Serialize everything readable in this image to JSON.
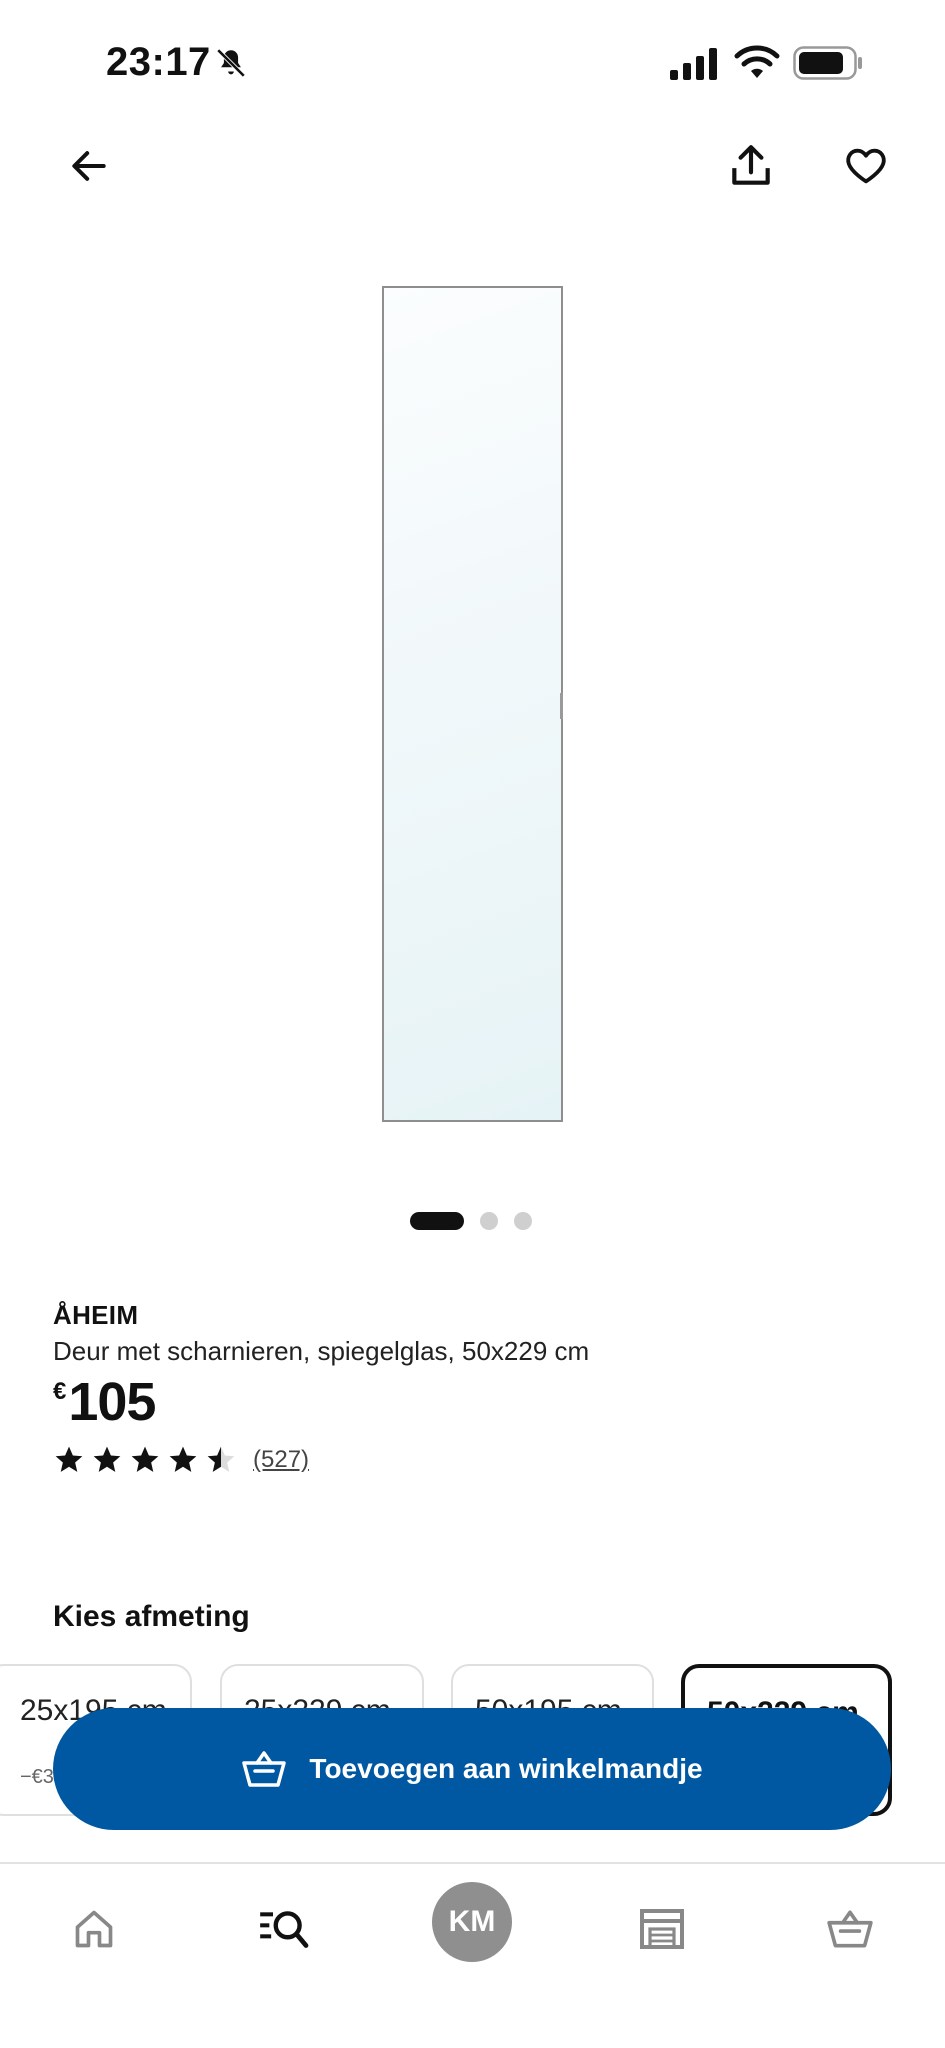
{
  "status_bar": {
    "time": "23:17",
    "icons": [
      "bell-slash-icon",
      "cellular-signal-icon",
      "wifi-icon",
      "battery-icon"
    ]
  },
  "top_bar": {
    "icons": [
      "arrow-left-icon",
      "share-icon",
      "heart-icon"
    ]
  },
  "carousel": {
    "total_images": 3,
    "active_index": 0
  },
  "product": {
    "name": "ÅHEIM",
    "description": "Deur met scharnieren, spiegelglas, 50x229 cm",
    "currency": "€",
    "price": "105",
    "rating": 4.5,
    "rating_max": 5,
    "review_count": "(527)"
  },
  "size_section": {
    "title": "Kies afmeting",
    "options": [
      {
        "label": "25x195 cm",
        "sub": "−€35",
        "selected": false
      },
      {
        "label": "25x229 cm",
        "sub": "",
        "selected": false
      },
      {
        "label": "50x195 cm",
        "sub": "",
        "selected": false
      },
      {
        "label": "50x229 cm",
        "sub": "",
        "selected": true
      }
    ]
  },
  "cta": {
    "label": "Toevoegen aan winkelmandje",
    "icon": "basket-icon",
    "color": "#0058a3"
  },
  "bottom_nav": {
    "items": [
      {
        "name": "home",
        "icon": "home-icon"
      },
      {
        "name": "search",
        "icon": "search-list-icon"
      },
      {
        "name": "profile",
        "initials": "KM"
      },
      {
        "name": "stores",
        "icon": "store-icon"
      },
      {
        "name": "cart",
        "icon": "basket-icon"
      }
    ]
  }
}
